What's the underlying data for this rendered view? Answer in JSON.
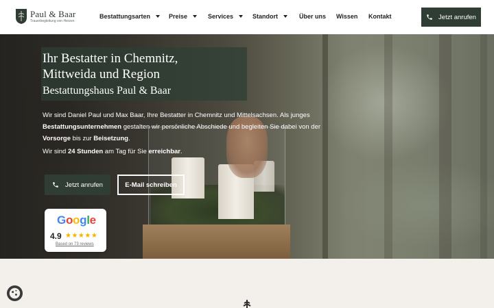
{
  "header": {
    "logo": {
      "name": "Paul & Baar",
      "tagline": "Trauerbegleitung von Herzen"
    },
    "nav": [
      {
        "label": "Bestattungsarten",
        "dropdown": true
      },
      {
        "label": "Preise",
        "dropdown": true
      },
      {
        "label": "Services",
        "dropdown": true
      },
      {
        "label": "Standort",
        "dropdown": true
      },
      {
        "label": "Über uns",
        "dropdown": false
      },
      {
        "label": "Wissen",
        "dropdown": false
      },
      {
        "label": "Kontakt",
        "dropdown": false
      }
    ],
    "call_button": {
      "label": "Jetzt anrufen",
      "icon": "phone-icon"
    }
  },
  "hero": {
    "title_line1": "Ihr Bestatter in Chemnitz,",
    "title_line2": "Mittweida und Region",
    "subtitle": "Bestattungshaus Paul & Baar",
    "paragraph": {
      "p1": "Wir sind Daniel Paul und Max Baar, Ihre Bestatter in Chemnitz und Mittelsachsen. Als junges ",
      "b1": "Bestattungsunternehmen",
      "p2": " gestalten wir persönliche Abschiede und begleiten Sie dabei von der ",
      "b2": "Vorsorge",
      "p3": " bis zur ",
      "b3": "Beisetzung",
      "p4": "."
    },
    "availability": {
      "p1": "Wir sind ",
      "b1": "24 Stunden",
      "p2": " am Tag für Sie ",
      "b2": "erreichbar",
      "p3": "."
    },
    "buttons": {
      "call": "Jetzt anrufen",
      "mail": "E-Mail schreiben"
    },
    "google_review": {
      "brand": "Google",
      "rating": "4.9",
      "stars": "★★★★★",
      "reviews_text": "Based on 73 reviews"
    }
  },
  "colors": {
    "accent": "#2f3d35",
    "star": "#f4b400"
  }
}
